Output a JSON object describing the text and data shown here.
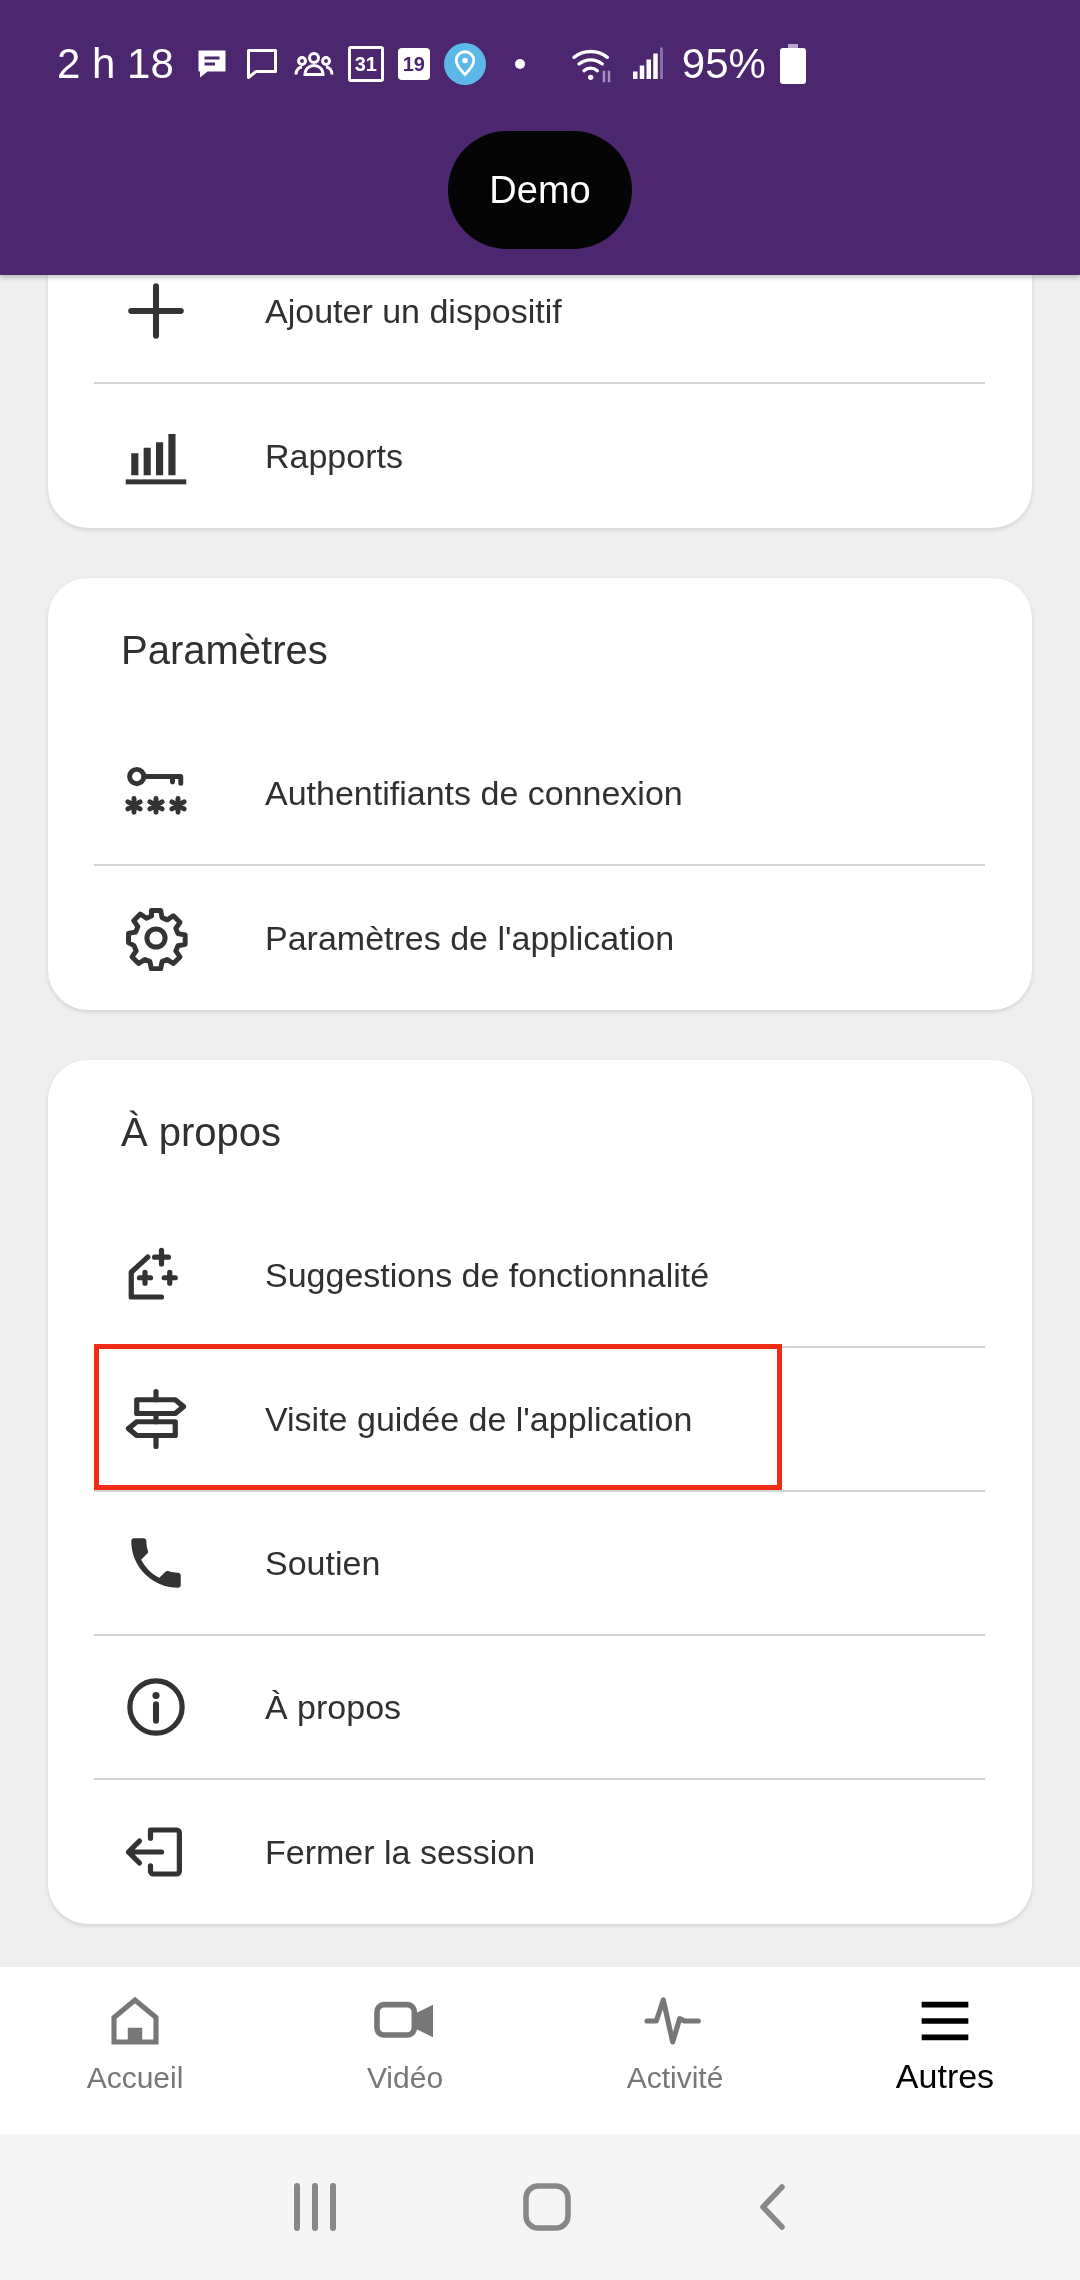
{
  "status_bar": {
    "time": "2 h 18",
    "calendar_dates": [
      "31",
      "19"
    ],
    "battery": "95%"
  },
  "header": {
    "badge": "Demo"
  },
  "sections": [
    {
      "items": [
        {
          "label": "Ajouter un dispositif",
          "highlighted": false
        },
        {
          "label": "Rapports",
          "highlighted": false
        }
      ]
    },
    {
      "title": "Paramètres",
      "items": [
        {
          "label": "Authentifiants de connexion",
          "highlighted": false
        },
        {
          "label": "Paramètres de l'application",
          "highlighted": false
        }
      ]
    },
    {
      "title": "À propos",
      "items": [
        {
          "label": "Suggestions de fonctionnalité",
          "highlighted": false
        },
        {
          "label": "Visite guidée de l'application",
          "highlighted": true
        },
        {
          "label": "Soutien",
          "highlighted": false
        },
        {
          "label": "À propos",
          "highlighted": false
        },
        {
          "label": "Fermer la session",
          "highlighted": false
        }
      ]
    }
  ],
  "bottom_nav": [
    {
      "label": "Accueil",
      "selected": false
    },
    {
      "label": "Vidéo",
      "selected": false
    },
    {
      "label": "Activité",
      "selected": false
    },
    {
      "label": "Autres",
      "selected": true
    }
  ]
}
